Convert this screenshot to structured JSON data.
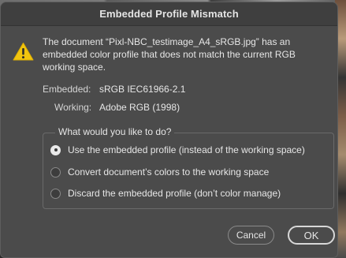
{
  "dialog": {
    "title": "Embedded Profile Mismatch",
    "message": "The document “Pixl-NBC_testimage_A4_sRGB.jpg” has an embedded color profile that does not match the current RGB working space.",
    "embedded_label": "Embedded:",
    "embedded_value": "sRGB IEC61966-2.1",
    "working_label": "Working:",
    "working_value": "Adobe RGB (1998)",
    "question": "What would you like to do?",
    "options": [
      {
        "label": "Use the embedded profile (instead of the working space)",
        "selected": true
      },
      {
        "label": "Convert document’s colors to the working space",
        "selected": false
      },
      {
        "label": "Discard the embedded profile (don’t color manage)",
        "selected": false
      }
    ],
    "cancel_label": "Cancel",
    "ok_label": "OK",
    "warning_icon": "warning-triangle-icon",
    "warning_color": "#f1c40f"
  }
}
